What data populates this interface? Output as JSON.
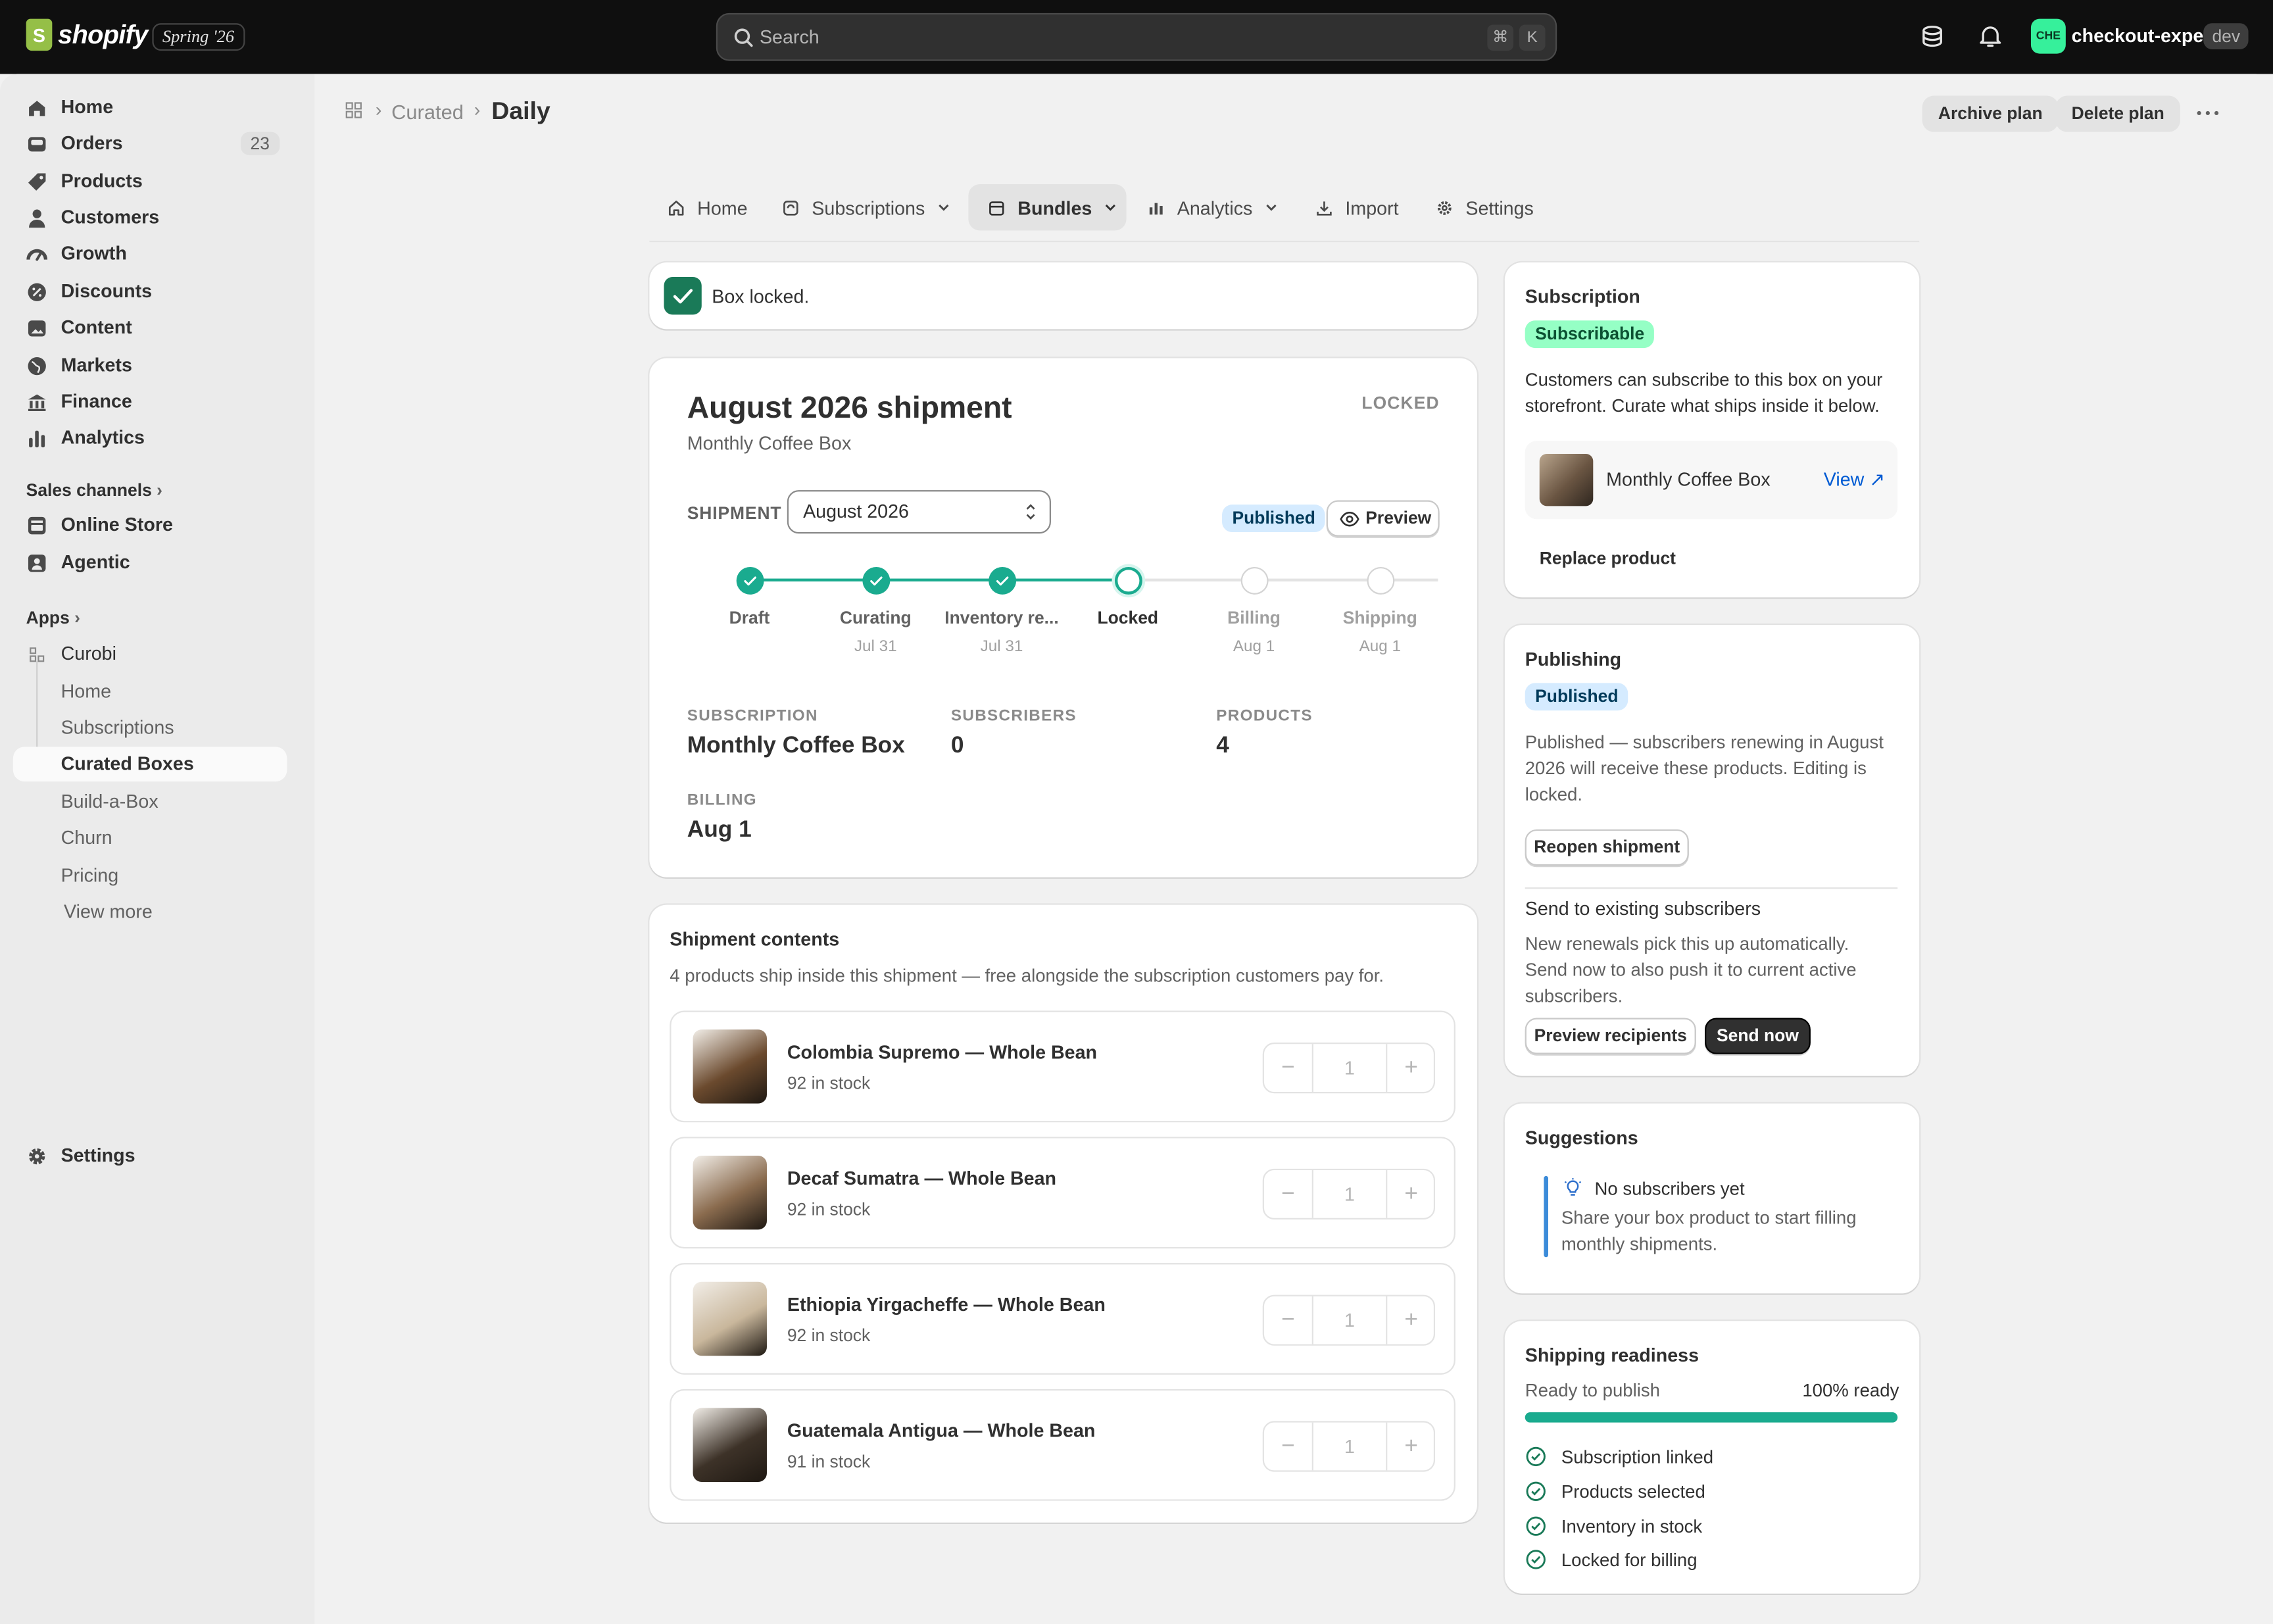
{
  "topbar": {
    "logo_glyph": "S",
    "logo_text": "shopify",
    "edition": "Spring '26",
    "search_placeholder": "Search",
    "kbd_cmd": "⌘",
    "kbd_k": "K",
    "store_avatar": "CHE",
    "store_name": "checkout-expert",
    "env_badge": "dev"
  },
  "sidebar": {
    "items": [
      {
        "label": "Home",
        "icon": "home-icon"
      },
      {
        "label": "Orders",
        "icon": "inbox-icon",
        "count": "23"
      },
      {
        "label": "Products",
        "icon": "tag-icon"
      },
      {
        "label": "Customers",
        "icon": "person-icon"
      },
      {
        "label": "Growth",
        "icon": "gauge-icon"
      },
      {
        "label": "Discounts",
        "icon": "discount-icon"
      },
      {
        "label": "Content",
        "icon": "content-icon"
      },
      {
        "label": "Markets",
        "icon": "globe-icon"
      },
      {
        "label": "Finance",
        "icon": "bank-icon"
      },
      {
        "label": "Analytics",
        "icon": "bar-chart-icon"
      }
    ],
    "sales_channels_heading": "Sales channels",
    "channels": [
      {
        "label": "Online Store",
        "icon": "store-icon"
      },
      {
        "label": "Agentic",
        "icon": "agent-icon"
      }
    ],
    "apps_heading": "Apps",
    "app_name": "Curobi",
    "app_items": [
      "Home",
      "Subscriptions",
      "Curated Boxes",
      "Build-a-Box",
      "Churn",
      "Pricing"
    ],
    "view_more": "View more",
    "settings": "Settings"
  },
  "header": {
    "breadcrumb_parent": "Curated",
    "breadcrumb_sep": "›",
    "title": "Daily",
    "archive_label": "Archive plan",
    "delete_label": "Delete plan"
  },
  "tabs": [
    "Home",
    "Subscriptions",
    "Bundles",
    "Analytics",
    "Import",
    "Settings"
  ],
  "toast": {
    "text": "Box locked."
  },
  "shipment": {
    "title": "August 2026 shipment",
    "subtitle": "Monthly Coffee Box",
    "status_label": "LOCKED",
    "published_badge": "Published",
    "preview_label": "Preview",
    "shipment_label": "SHIPMENT",
    "shipment_value": "August 2026",
    "steps": [
      {
        "name": "Draft",
        "date": "",
        "state": "done"
      },
      {
        "name": "Curating",
        "date": "Jul 31",
        "state": "done"
      },
      {
        "name": "Inventory re...",
        "date": "Jul 31",
        "state": "done"
      },
      {
        "name": "Locked",
        "date": "",
        "state": "current"
      },
      {
        "name": "Billing",
        "date": "Aug 1",
        "state": "todo"
      },
      {
        "name": "Shipping",
        "date": "Aug 1",
        "state": "todo"
      }
    ],
    "stats": {
      "subscription_label": "SUBSCRIPTION",
      "subscription_value": "Monthly Coffee Box",
      "subscribers_label": "SUBSCRIBERS",
      "subscribers_value": "0",
      "products_label": "PRODUCTS",
      "products_value": "4",
      "billing_label": "BILLING",
      "billing_value": "Aug 1"
    }
  },
  "contents": {
    "heading": "Shipment contents",
    "description": "4 products ship inside this shipment — free alongside the subscription customers pay for.",
    "products": [
      {
        "name": "Colombia Supremo — Whole Bean",
        "stock": "92 in stock",
        "qty": "1",
        "color": "#6b4a2e"
      },
      {
        "name": "Decaf Sumatra — Whole Bean",
        "stock": "92 in stock",
        "qty": "1",
        "color": "#8a6b4e"
      },
      {
        "name": "Ethiopia Yirgacheffe — Whole Bean",
        "stock": "92 in stock",
        "qty": "1",
        "color": "#c9b79c"
      },
      {
        "name": "Guatemala Antigua — Whole Bean",
        "stock": "91 in stock",
        "qty": "1",
        "color": "#3d3228"
      }
    ],
    "minus": "−",
    "plus": "+"
  },
  "subscription_card": {
    "heading": "Subscription",
    "badge": "Subscribable",
    "text": "Customers can subscribe to this box on your storefront. Curate what ships inside it below.",
    "product_name": "Monthly Coffee Box",
    "view_label": "View ↗",
    "replace_label": "Replace product"
  },
  "publishing_card": {
    "heading": "Publishing",
    "badge": "Published",
    "text": "Published — subscribers renewing in August 2026 will receive these products. Editing is locked.",
    "reopen_label": "Reopen shipment",
    "send_heading": "Send to existing subscribers",
    "send_text": "New renewals pick this up automatically. Send now to also push it to current active subscribers.",
    "preview_recipients_label": "Preview recipients",
    "send_now_label": "Send now"
  },
  "suggestions_card": {
    "heading": "Suggestions",
    "title": "No subscribers yet",
    "text": "Share your box product to start filling monthly shipments."
  },
  "readiness_card": {
    "heading": "Shipping readiness",
    "label": "Ready to publish",
    "value_text": "100% ready",
    "progress": 1.0,
    "checks": [
      "Subscription linked",
      "Products selected",
      "Inventory in stock",
      "Locked for billing"
    ]
  },
  "colors": {
    "accent": "#1aab8f",
    "toast_green": "#1a7a58",
    "dark": "#303030"
  }
}
